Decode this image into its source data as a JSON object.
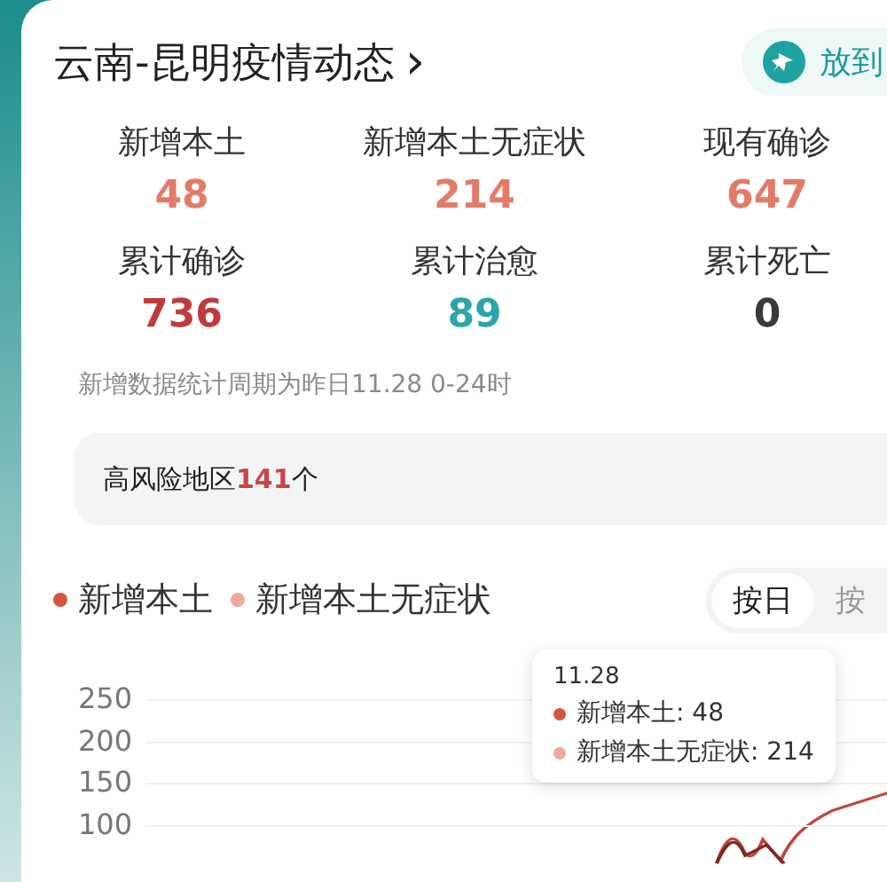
{
  "header": {
    "title": "云南-昆明疫情动态",
    "chevron": "›",
    "pin_button": "放到"
  },
  "stats": [
    {
      "label": "新增本土",
      "value": "48",
      "color": "#e27c68"
    },
    {
      "label": "新增本土无症状",
      "value": "214",
      "color": "#e27c68"
    },
    {
      "label": "现有确诊",
      "value": "647",
      "color": "#e27c68"
    },
    {
      "label": "累计确诊",
      "value": "736",
      "color": "#c03a3c"
    },
    {
      "label": "累计治愈",
      "value": "89",
      "color": "#2ba5a8"
    },
    {
      "label": "累计死亡",
      "value": "0",
      "color": "#3a3a3a"
    }
  ],
  "note": "新增数据统计周期为昨日11.28 0-24时",
  "risk": {
    "label": "高风险地区",
    "count": "141",
    "unit": "个"
  },
  "legend": [
    {
      "label": "新增本土",
      "color": "#d5563f"
    },
    {
      "label": "新增本土无症状",
      "color": "#eca99c"
    }
  ],
  "period_tabs": [
    {
      "label": "按日",
      "selected": true
    },
    {
      "label": "按",
      "selected": false
    }
  ],
  "chart": {
    "y_labels": [
      "250",
      "200",
      "150",
      "100"
    ]
  },
  "tooltip": {
    "date": "11.28",
    "rows": [
      {
        "text": "新增本土: 48",
        "color": "#d5563f"
      },
      {
        "text": "新增本土无症状: 214",
        "color": "#eca99c"
      }
    ]
  }
}
